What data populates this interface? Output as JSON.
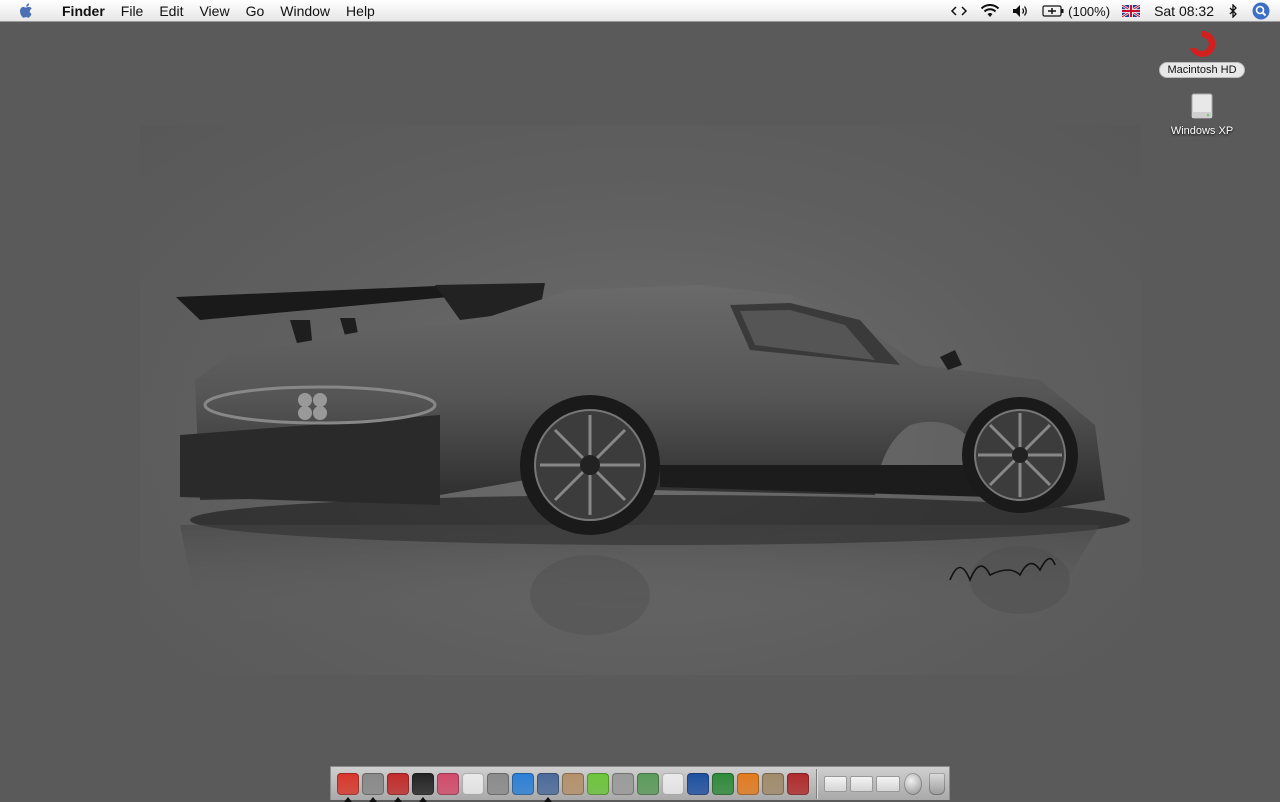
{
  "menubar": {
    "menus": [
      "Finder",
      "File",
      "Edit",
      "View",
      "Go",
      "Window",
      "Help"
    ],
    "status": {
      "sync_icon": "code-arrows-icon",
      "wifi_icon": "wifi-icon",
      "volume_icon": "volume-icon",
      "battery_icon": "battery-icon",
      "battery_text": "(100%)",
      "input_flag_icon": "uk-flag-icon",
      "clock": "Sat 08:32",
      "bluetooth_icon": "bluetooth-icon",
      "spotlight_icon": "spotlight-search-icon"
    }
  },
  "desktop": {
    "icons": [
      {
        "label": "Macintosh HD",
        "icon": "hard-drive-red-icon",
        "selected": true
      },
      {
        "label": "Windows XP",
        "icon": "hard-drive-icon",
        "selected": false
      }
    ]
  },
  "dock": {
    "apps": [
      {
        "name": "finder-icon",
        "color": "#d8362a",
        "running": true
      },
      {
        "name": "system-preferences-icon",
        "color": "#888888",
        "running": true
      },
      {
        "name": "safari-icon",
        "color": "#c22a2a",
        "running": true
      },
      {
        "name": "terminal-icon",
        "color": "#222222",
        "running": true
      },
      {
        "name": "photo-booth-icon",
        "color": "#d24a6a",
        "running": false
      },
      {
        "name": "ical-icon",
        "color": "#e9e9e9",
        "running": false
      },
      {
        "name": "sync-icon",
        "color": "#8a8a8a",
        "running": false
      },
      {
        "name": "quicktime-icon",
        "color": "#2b7fd6",
        "running": false
      },
      {
        "name": "itunes-icon",
        "color": "#4a6a9a",
        "running": true
      },
      {
        "name": "address-book-icon",
        "color": "#b4906a",
        "running": false
      },
      {
        "name": "limewire-icon",
        "color": "#6bc43a",
        "running": false
      },
      {
        "name": "preview-icon",
        "color": "#9a9a9a",
        "running": false
      },
      {
        "name": "script-editor-icon",
        "color": "#5a9a5a",
        "running": false
      },
      {
        "name": "textedit-icon",
        "color": "#eaeaea",
        "running": false
      },
      {
        "name": "word-icon",
        "color": "#1d4fa0",
        "running": false
      },
      {
        "name": "utorrent-icon",
        "color": "#2f8a3a",
        "running": false
      },
      {
        "name": "firefox-icon",
        "color": "#e27a1e",
        "running": false
      },
      {
        "name": "gimp-icon",
        "color": "#a08a6a",
        "running": false
      },
      {
        "name": "messenger-icon",
        "color": "#b02a2a",
        "running": false
      }
    ],
    "stacks": [
      {
        "name": "applications-stack-icon"
      },
      {
        "name": "documents-stack-icon"
      },
      {
        "name": "downloads-stack-icon"
      },
      {
        "name": "network-globe-icon"
      },
      {
        "name": "trash-icon"
      }
    ]
  }
}
